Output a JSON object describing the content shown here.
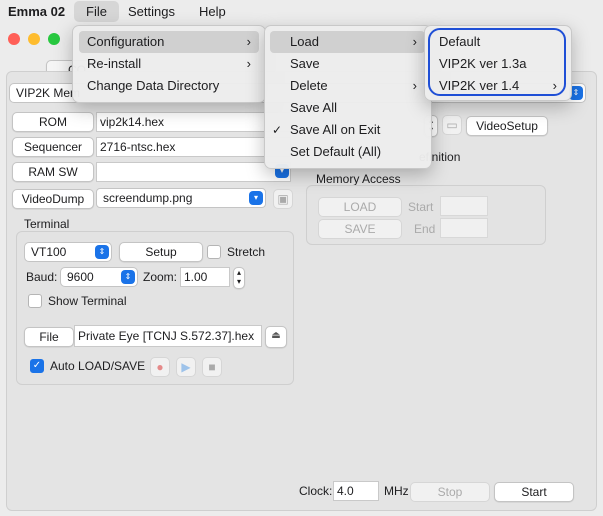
{
  "menubar": {
    "app": "Emma 02",
    "items": [
      "File",
      "Settings",
      "Help"
    ]
  },
  "tab_partial": "CO",
  "computer_select": "VIP2K Mem",
  "rows": {
    "rom": {
      "button": "ROM",
      "value": "vip2k14.hex"
    },
    "sequencer": {
      "button": "Sequencer",
      "value": "2716-ntsc.hex"
    },
    "ramsw": {
      "button": "RAM SW",
      "value": ""
    },
    "videodump": {
      "button": "VideoDump",
      "value": "screendump.png"
    }
  },
  "terminal": {
    "title": "Terminal",
    "type": "VT100",
    "setup_label": "Setup",
    "stretch_label": "Stretch",
    "baud_label": "Baud:",
    "baud_value": "9600",
    "zoom_label": "Zoom:",
    "zoom_value": "1.00",
    "show_terminal_label": "Show Terminal",
    "file_button": "File",
    "file_value": "Private Eye [TCNJ S.572.37].hex",
    "auto_label": "Auto LOAD/SAVE"
  },
  "right": {
    "videosetup_label": "VideoSetup",
    "definition_partial": "efinition",
    "memory_title": "Memory Access",
    "load_label": "LOAD",
    "save_label": "SAVE",
    "start_label": "Start",
    "end_label": "End"
  },
  "bottom": {
    "clock_label": "Clock:",
    "clock_value": "4.0",
    "mhz_label": "MHz",
    "stop_label": "Stop",
    "start_label": "Start"
  },
  "file_menu": [
    "Configuration",
    "Re-install",
    "Change Data Directory"
  ],
  "config_menu": [
    "Load",
    "Save",
    "Delete",
    "Save All",
    "Save All on Exit",
    "Set Default (All)"
  ],
  "load_menu": [
    "Default",
    "VIP2K ver 1.3a",
    "VIP2K ver 1.4"
  ],
  "colors": {
    "accent": "#1a73e8",
    "highlight_ring": "#1f4fd6"
  }
}
